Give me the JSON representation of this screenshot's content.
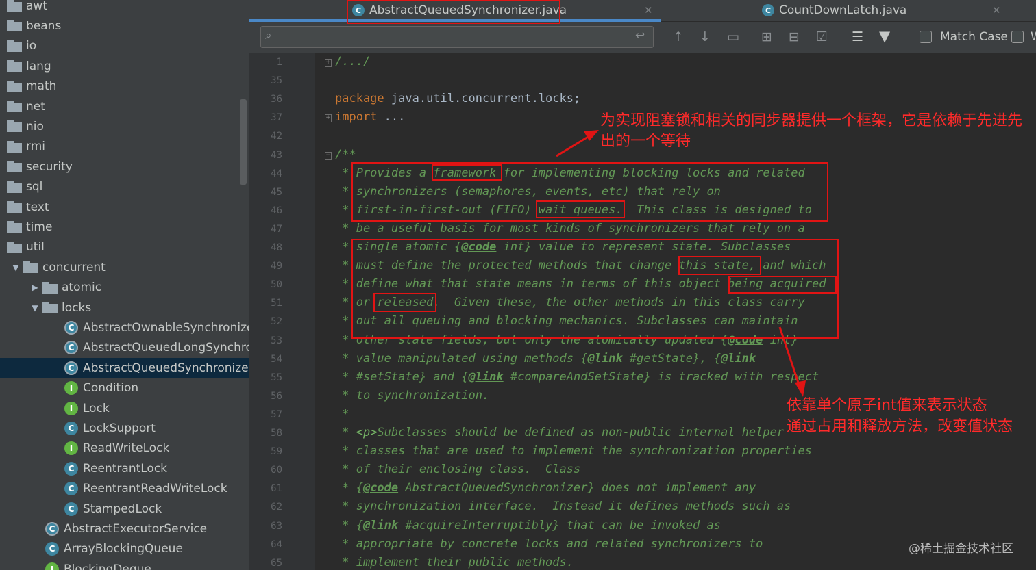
{
  "sidebar": {
    "items": [
      {
        "label": "awt",
        "kind": "folder",
        "indent": 0,
        "arrow": ""
      },
      {
        "label": "beans",
        "kind": "folder",
        "indent": 0,
        "arrow": ""
      },
      {
        "label": "io",
        "kind": "folder",
        "indent": 0,
        "arrow": ""
      },
      {
        "label": "lang",
        "kind": "folder",
        "indent": 0,
        "arrow": ""
      },
      {
        "label": "math",
        "kind": "folder",
        "indent": 0,
        "arrow": ""
      },
      {
        "label": "net",
        "kind": "folder",
        "indent": 0,
        "arrow": ""
      },
      {
        "label": "nio",
        "kind": "folder",
        "indent": 0,
        "arrow": ""
      },
      {
        "label": "rmi",
        "kind": "folder",
        "indent": 0,
        "arrow": ""
      },
      {
        "label": "security",
        "kind": "folder",
        "indent": 0,
        "arrow": ""
      },
      {
        "label": "sql",
        "kind": "folder",
        "indent": 0,
        "arrow": ""
      },
      {
        "label": "text",
        "kind": "folder",
        "indent": 0,
        "arrow": ""
      },
      {
        "label": "time",
        "kind": "folder",
        "indent": 0,
        "arrow": ""
      },
      {
        "label": "util",
        "kind": "folder",
        "indent": 0,
        "arrow": ""
      },
      {
        "label": "concurrent",
        "kind": "folder",
        "indent": 1,
        "arrow": "expanded"
      },
      {
        "label": "atomic",
        "kind": "folder",
        "indent": 2,
        "arrow": "collapsed"
      },
      {
        "label": "locks",
        "kind": "folder",
        "indent": 2,
        "arrow": "expanded"
      },
      {
        "label": "AbstractOwnableSynchronizer",
        "kind": "abstract-class",
        "indent": 3,
        "arrow": ""
      },
      {
        "label": "AbstractQueuedLongSynchronizer",
        "kind": "abstract-class",
        "indent": 3,
        "arrow": ""
      },
      {
        "label": "AbstractQueuedSynchronizer",
        "kind": "abstract-class",
        "indent": 3,
        "arrow": "",
        "selected": true
      },
      {
        "label": "Condition",
        "kind": "interface",
        "indent": 3,
        "arrow": ""
      },
      {
        "label": "Lock",
        "kind": "interface",
        "indent": 3,
        "arrow": ""
      },
      {
        "label": "LockSupport",
        "kind": "class",
        "indent": 3,
        "arrow": ""
      },
      {
        "label": "ReadWriteLock",
        "kind": "interface",
        "indent": 3,
        "arrow": ""
      },
      {
        "label": "ReentrantLock",
        "kind": "class",
        "indent": 3,
        "arrow": ""
      },
      {
        "label": "ReentrantReadWriteLock",
        "kind": "class",
        "indent": 3,
        "arrow": ""
      },
      {
        "label": "StampedLock",
        "kind": "class",
        "indent": 3,
        "arrow": ""
      },
      {
        "label": "AbstractExecutorService",
        "kind": "abstract-class",
        "indent": 2,
        "arrow": ""
      },
      {
        "label": "ArrayBlockingQueue",
        "kind": "class",
        "indent": 2,
        "arrow": ""
      },
      {
        "label": "BlockingDeque",
        "kind": "interface",
        "indent": 2,
        "arrow": ""
      }
    ]
  },
  "tabs": [
    {
      "label": "AbstractQueuedSynchronizer.java",
      "active": true
    },
    {
      "label": "CountDownLatch.java",
      "active": false
    }
  ],
  "findbar": {
    "search_value": "",
    "match_case_label": "Match Case",
    "words_label_partial": "W"
  },
  "lines": [
    {
      "n": "1",
      "text": "/.../",
      "fold": "+"
    },
    {
      "n": "35",
      "text": ""
    },
    {
      "n": "36",
      "text": "package java.util.concurrent.locks;"
    },
    {
      "n": "37",
      "text": "import ...",
      "fold": "+"
    },
    {
      "n": "42",
      "text": ""
    },
    {
      "n": "43",
      "text": "/**",
      "fold": "-"
    },
    {
      "n": "44",
      "text": " * Provides a framework for implementing blocking locks and related"
    },
    {
      "n": "45",
      "text": " * synchronizers (semaphores, events, etc) that rely on"
    },
    {
      "n": "46",
      "text": " * first-in-first-out (FIFO) wait queues.  This class is designed to"
    },
    {
      "n": "47",
      "text": " * be a useful basis for most kinds of synchronizers that rely on a"
    },
    {
      "n": "48",
      "text": " * single atomic {@code int} value to represent state. Subclasses"
    },
    {
      "n": "49",
      "text": " * must define the protected methods that change this state, and which"
    },
    {
      "n": "50",
      "text": " * define what that state means in terms of this object being acquired"
    },
    {
      "n": "51",
      "text": " * or released.  Given these, the other methods in this class carry"
    },
    {
      "n": "52",
      "text": " * out all queuing and blocking mechanics. Subclasses can maintain"
    },
    {
      "n": "53",
      "text": " * other state fields, but only the atomically updated {@code int}"
    },
    {
      "n": "54",
      "text": " * value manipulated using methods {@link #getState}, {@link"
    },
    {
      "n": "55",
      "text": " * #setState} and {@link #compareAndSetState} is tracked with respect"
    },
    {
      "n": "56",
      "text": " * to synchronization."
    },
    {
      "n": "57",
      "text": " *"
    },
    {
      "n": "58",
      "text": " * <p>Subclasses should be defined as non-public internal helper"
    },
    {
      "n": "59",
      "text": " * classes that are used to implement the synchronization properties"
    },
    {
      "n": "60",
      "text": " * of their enclosing class.  Class"
    },
    {
      "n": "61",
      "text": " * {@code AbstractQueuedSynchronizer} does not implement any"
    },
    {
      "n": "62",
      "text": " * synchronization interface.  Instead it defines methods such as"
    },
    {
      "n": "63",
      "text": " * {@link #acquireInterruptibly} that can be invoked as"
    },
    {
      "n": "64",
      "text": " * appropriate by concrete locks and related synchronizers to"
    },
    {
      "n": "65",
      "text": " * implement their public methods."
    }
  ],
  "annotations": {
    "top": "为实现阻塞锁和相关的同步器提供一个框架，它是依赖于先进先出的一个等待",
    "bottom_line1": "依靠单个原子int值来表示状态",
    "bottom_line2": "通过占用和释放方法，改变值状态"
  },
  "watermark": "@稀土掘金技术社区",
  "colors": {
    "editor_bg": "#2b2b2b",
    "panel_bg": "#3c3f41",
    "comment": "#629755",
    "keyword": "#cc7832",
    "annotation_red": "#e11414",
    "selection": "#0d293e"
  }
}
